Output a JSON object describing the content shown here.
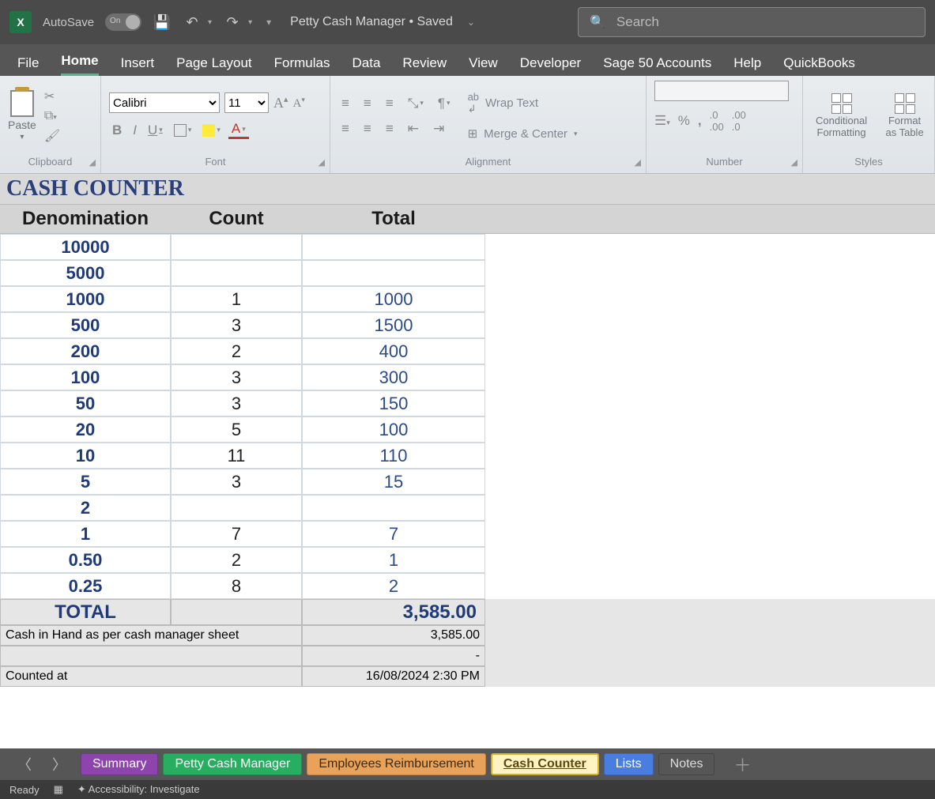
{
  "titlebar": {
    "autosave_label": "AutoSave",
    "toggle_on": "On",
    "doc_title": "Petty Cash Manager • Saved",
    "search_placeholder": "Search"
  },
  "menu": [
    "File",
    "Home",
    "Insert",
    "Page Layout",
    "Formulas",
    "Data",
    "Review",
    "View",
    "Developer",
    "Sage 50 Accounts",
    "Help",
    "QuickBooks"
  ],
  "menu_active": 1,
  "ribbon": {
    "clipboard": {
      "paste": "Paste",
      "label": "Clipboard"
    },
    "font": {
      "name": "Calibri",
      "size": "11",
      "label": "Font"
    },
    "alignment": {
      "wrap": "Wrap Text",
      "merge": "Merge & Center",
      "label": "Alignment"
    },
    "number": {
      "label": "Number"
    },
    "styles": {
      "conditional": "Conditional Formatting",
      "formatas": "Format as Table",
      "label": "Styles"
    }
  },
  "sheet": {
    "title": "CASH COUNTER",
    "headers": [
      "Denomination",
      "Count",
      "Total"
    ],
    "rows": [
      [
        "10000",
        "",
        ""
      ],
      [
        "5000",
        "",
        ""
      ],
      [
        "1000",
        "1",
        "1000"
      ],
      [
        "500",
        "3",
        "1500"
      ],
      [
        "200",
        "2",
        "400"
      ],
      [
        "100",
        "3",
        "300"
      ],
      [
        "50",
        "3",
        "150"
      ],
      [
        "20",
        "5",
        "100"
      ],
      [
        "10",
        "11",
        "110"
      ],
      [
        "5",
        "3",
        "15"
      ],
      [
        "2",
        "",
        ""
      ],
      [
        "1",
        "7",
        "7"
      ],
      [
        "0.50",
        "2",
        "1"
      ],
      [
        "0.25",
        "8",
        "2"
      ]
    ],
    "total_label": "TOTAL",
    "total_value": "3,585.00",
    "foot1_label": "Cash in Hand as per cash manager sheet",
    "foot1_value": "3,585.00",
    "foot2_value": "-",
    "foot3_label": "Counted at",
    "foot3_value": "16/08/2024 2:30 PM"
  },
  "tabs": [
    {
      "name": "Summary",
      "cls": "purple"
    },
    {
      "name": "Petty Cash Manager",
      "cls": "green"
    },
    {
      "name": "Employees Reimbursement",
      "cls": "orange"
    },
    {
      "name": "Cash  Counter",
      "cls": "yellow"
    },
    {
      "name": "Lists",
      "cls": "blue"
    },
    {
      "name": "Notes",
      "cls": "plain"
    }
  ],
  "status": {
    "ready": "Ready",
    "acc": "Accessibility: Investigate"
  }
}
